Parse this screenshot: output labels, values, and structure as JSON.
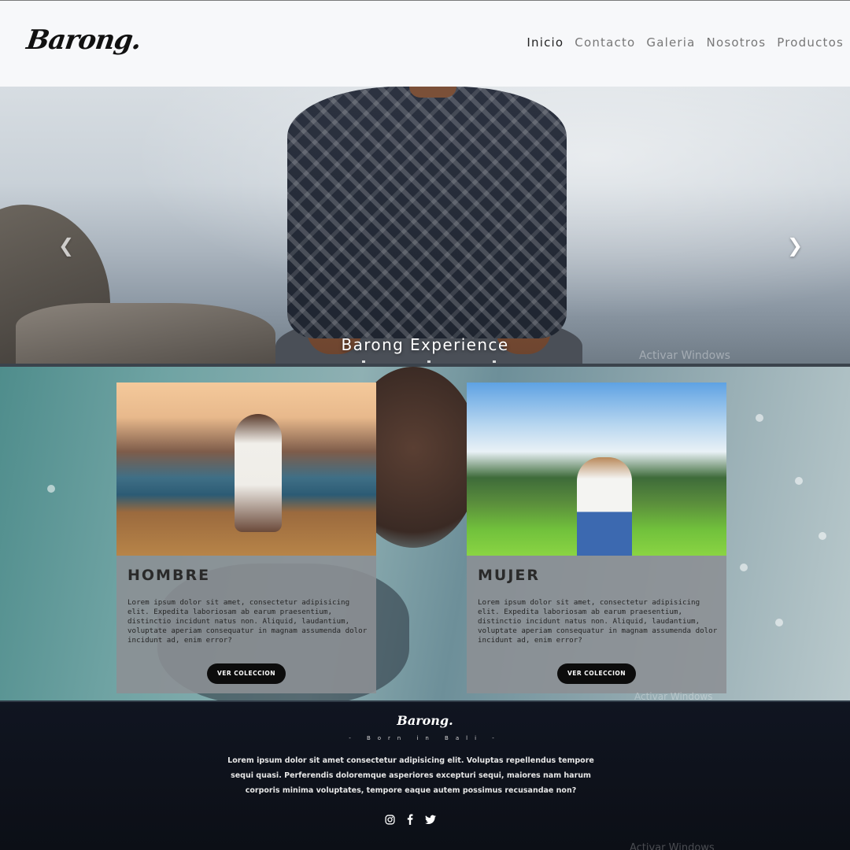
{
  "brand": {
    "logo": "Barong."
  },
  "nav": {
    "items": [
      {
        "label": "Inicio",
        "active": true
      },
      {
        "label": "Contacto",
        "active": false
      },
      {
        "label": "Galeria",
        "active": false
      },
      {
        "label": "Nosotros",
        "active": false
      },
      {
        "label": "Productos",
        "active": false
      }
    ]
  },
  "hero": {
    "caption": "Barong Experience",
    "watermark": "Activar Windows",
    "indicator_count": 3
  },
  "collections": {
    "cards": [
      {
        "title": "HOMBRE",
        "text": "Lorem ipsum dolor sit amet, consectetur adipisicing elit. Expedita laboriosam ab earum praesentium, distinctio incidunt natus non. Aliquid, laudantium, voluptate aperiam consequatur in magnam assumenda dolor incidunt ad, enim error?",
        "button": "VER COLECCION"
      },
      {
        "title": "MUJER",
        "text": "Lorem ipsum dolor sit amet, consectetur adipisicing elit. Expedita laboriosam ab earum praesentium, distinctio incidunt natus non. Aliquid, laudantium, voluptate aperiam consequatur in magnam assumenda dolor incidunt ad, enim error?",
        "button": "VER COLECCION"
      }
    ],
    "watermark": "Activar Windows"
  },
  "footer": {
    "logo": "Barong.",
    "tagline": "- Born in Bali -",
    "text": "Lorem ipsum dolor sit amet consectetur adipisicing elit. Voluptas repellendus tempore sequi quasi. Perferendis doloremque asperiores excepturi sequi, maiores nam harum corporis minima voluptates, tempore eaque autem possimus recusandae non?",
    "social": [
      "instagram-icon",
      "facebook-icon",
      "twitter-icon"
    ],
    "watermark": "Activar Windows"
  },
  "colors": {
    "footer_bg": "#101521",
    "button_bg": "#0c0c0c",
    "nav_bg": "#f7f8fa"
  }
}
